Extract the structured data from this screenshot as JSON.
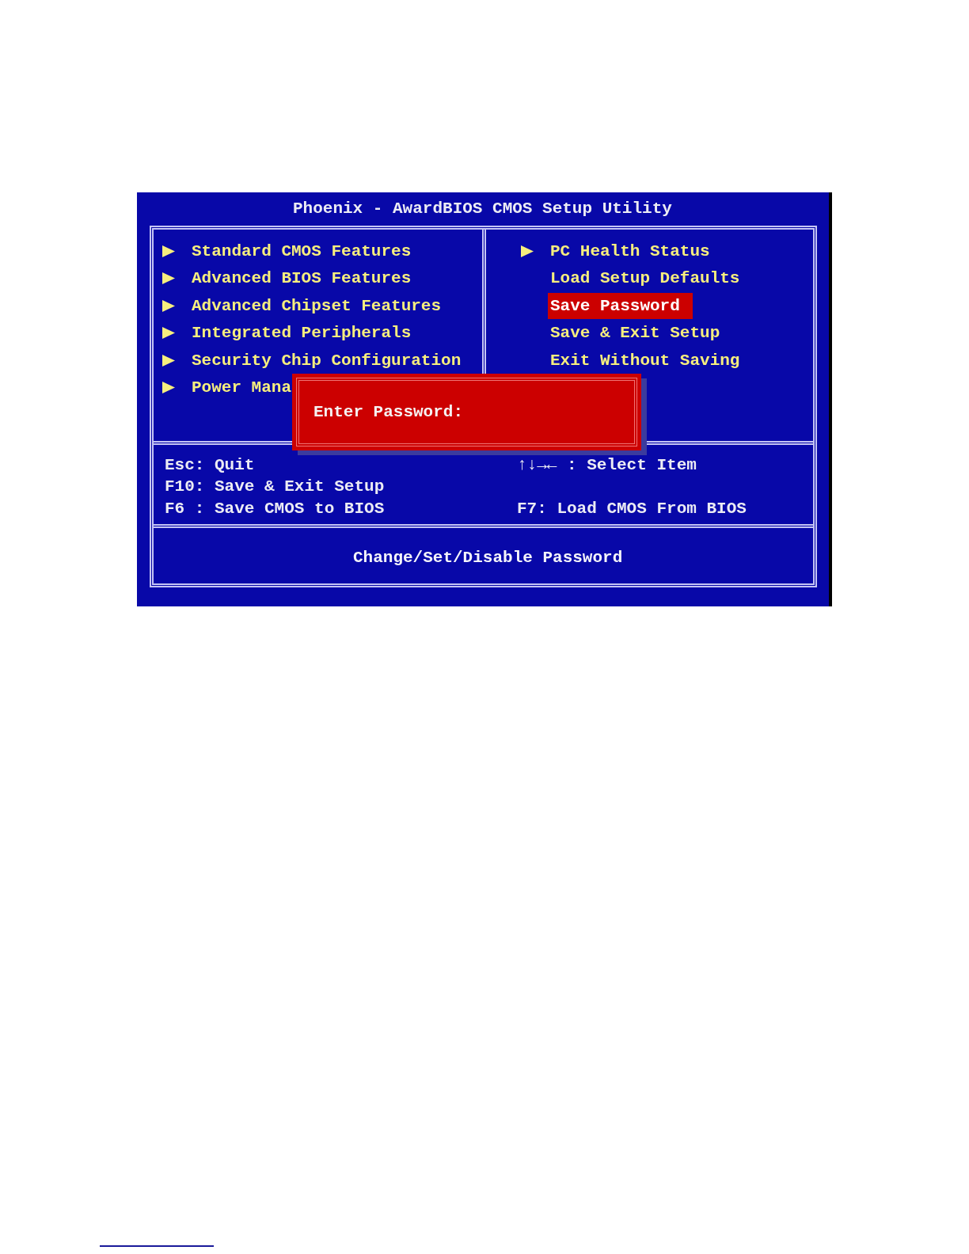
{
  "window": {
    "title": "Phoenix - AwardBIOS CMOS Setup Utility"
  },
  "menu_left": [
    {
      "label": "Standard CMOS Features",
      "submenu": true,
      "selected": false
    },
    {
      "label": "Advanced BIOS Features",
      "submenu": true,
      "selected": false
    },
    {
      "label": "Advanced Chipset Features",
      "submenu": true,
      "selected": false
    },
    {
      "label": "Integrated Peripherals",
      "submenu": true,
      "selected": false
    },
    {
      "label": "Security Chip Configuration",
      "submenu": true,
      "selected": false
    },
    {
      "label": "Power Mana",
      "submenu": true,
      "selected": false
    }
  ],
  "menu_right": [
    {
      "label": "PC Health Status",
      "submenu": true,
      "selected": false
    },
    {
      "label": "Load Setup Defaults",
      "submenu": false,
      "selected": false
    },
    {
      "label": "Save Password",
      "submenu": false,
      "selected": true
    },
    {
      "label": "Save & Exit Setup",
      "submenu": false,
      "selected": false
    },
    {
      "label": "Exit Without Saving",
      "submenu": false,
      "selected": false
    }
  ],
  "dialog": {
    "prompt": "Enter Password:"
  },
  "key_help": [
    {
      "left": "Esc: Quit",
      "right": "↑↓→← : Select Item"
    },
    {
      "left": "F10: Save & Exit Setup"
    },
    {
      "left": "F6 : Save CMOS to BIOS",
      "right": "F7: Load CMOS From BIOS"
    }
  ],
  "status_bar": {
    "text": "Change/Set/Disable Password"
  }
}
